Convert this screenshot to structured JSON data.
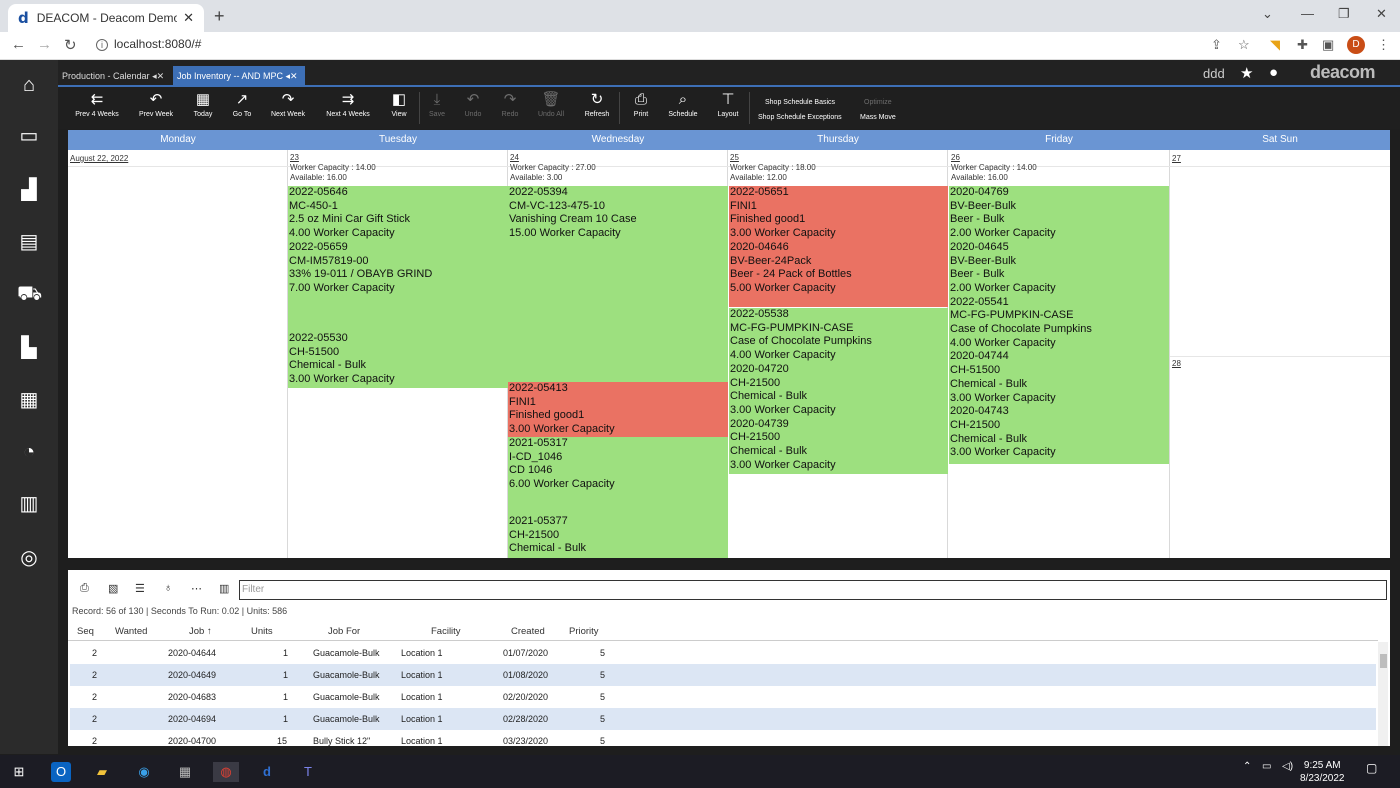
{
  "browser": {
    "tab_title": "DEACOM - Deacom Demo - Job",
    "url": "localhost:8080/#"
  },
  "app": {
    "tabs": [
      "Production - Calendar",
      "Job Inventory -- AND MPC"
    ],
    "logo": "deacom"
  },
  "toolbar": {
    "buttons": [
      "Prev 4 Weeks",
      "Prev Week",
      "Today",
      "Go To",
      "Next Week",
      "Next 4 Weeks",
      "View",
      "Save",
      "Undo",
      "Redo",
      "Undo All",
      "Refresh",
      "Print",
      "Schedule",
      "Layout"
    ],
    "links": [
      "Shop Schedule Basics",
      "Optimize",
      "Shop Schedule Exceptions",
      "Mass Move"
    ]
  },
  "calendar": {
    "days": [
      "Monday",
      "Tuesday",
      "Wednesday",
      "Thursday",
      "Friday",
      "Sat Sun"
    ],
    "monday": {
      "date": "August 22, 2022"
    },
    "tuesday": {
      "date": "23",
      "cap1": "Worker Capacity : 14.00",
      "cap2": "Available: 16.00"
    },
    "wednesday": {
      "date": "24",
      "cap1": "Worker Capacity : 27.00",
      "cap2": "Available: 3.00"
    },
    "thursday": {
      "date": "25",
      "cap1": "Worker Capacity : 18.00",
      "cap2": "Available: 12.00"
    },
    "friday": {
      "date": "26",
      "cap1": "Worker Capacity : 14.00",
      "cap2": "Available: 16.00"
    },
    "sat": {
      "date": "27"
    },
    "sun": {
      "date": "28"
    },
    "jobs": {
      "tue1": [
        "2022-05646",
        "MC-450-1",
        "2.5 oz Mini Car Gift Stick",
        "4.00 Worker Capacity",
        "2022-05659",
        "CM-IM57819-00",
        "33% 19-011 / OBAYB GRIND",
        "7.00 Worker Capacity"
      ],
      "tue2": [
        "2022-05530",
        "CH-51500",
        "Chemical - Bulk",
        "3.00 Worker Capacity"
      ],
      "wed1": [
        "2022-05394",
        "CM-VC-123-475-10",
        "Vanishing Cream 10 Case",
        "15.00 Worker Capacity"
      ],
      "wed2": [
        "2022-05413",
        "FINI1",
        "Finished good1",
        "3.00 Worker Capacity"
      ],
      "wed3": [
        "2021-05317",
        "I-CD_1046",
        "CD 1046",
        "6.00 Worker Capacity"
      ],
      "wed4": [
        "2021-05377",
        "CH-21500",
        "Chemical - Bulk"
      ],
      "thu1": [
        "2022-05651",
        "FINI1",
        "Finished good1",
        "3.00 Worker Capacity"
      ],
      "thu2": [
        "2020-04646",
        "BV-Beer-24Pack",
        "Beer - 24 Pack of Bottles",
        "5.00 Worker Capacity"
      ],
      "thu3": [
        "2022-05538",
        "MC-FG-PUMPKIN-CASE",
        "Case of Chocolate Pumpkins",
        "4.00 Worker Capacity",
        "2020-04720",
        "CH-21500",
        "Chemical - Bulk",
        "3.00 Worker Capacity",
        "2020-04739",
        "CH-21500",
        "Chemical - Bulk",
        "3.00 Worker Capacity"
      ],
      "fri1": [
        "2020-04769",
        "BV-Beer-Bulk",
        "Beer - Bulk",
        "2.00 Worker Capacity",
        "2020-04645",
        "BV-Beer-Bulk",
        "Beer - Bulk",
        "2.00 Worker Capacity",
        "2022-05541",
        "MC-FG-PUMPKIN-CASE",
        "Case of Chocolate Pumpkins",
        "4.00 Worker Capacity",
        "2020-04744",
        "CH-51500",
        "Chemical - Bulk",
        "3.00 Worker Capacity",
        "2020-04743",
        "CH-21500",
        "Chemical - Bulk",
        "3.00 Worker Capacity"
      ]
    }
  },
  "grid": {
    "filter_placeholder": "Filter",
    "record_info": "Record: 56 of 130 |  Seconds To Run: 0.02 |  Units: 586",
    "headers": [
      "Seq",
      "Wanted",
      "Job ↑",
      "Units",
      "Job For",
      "Facility",
      "Created",
      "Priority"
    ],
    "rows": [
      [
        "2",
        "",
        "2020-04644",
        "1",
        "Guacamole-Bulk",
        "Location 1",
        "01/07/2020",
        "5"
      ],
      [
        "2",
        "",
        "2020-04649",
        "1",
        "Guacamole-Bulk",
        "Location 1",
        "01/08/2020",
        "5"
      ],
      [
        "2",
        "",
        "2020-04683",
        "1",
        "Guacamole-Bulk",
        "Location 1",
        "02/20/2020",
        "5"
      ],
      [
        "2",
        "",
        "2020-04694",
        "1",
        "Guacamole-Bulk",
        "Location 1",
        "02/28/2020",
        "5"
      ],
      [
        "2",
        "",
        "2020-04700",
        "15",
        "Bully Stick 12\"",
        "Location 1",
        "03/23/2020",
        "5"
      ]
    ]
  },
  "taskbar": {
    "time": "9:25 AM",
    "date": "8/23/2022"
  },
  "colors": {
    "green": "#9de07f",
    "red": "#ea7263",
    "header": "#6a95d3"
  }
}
